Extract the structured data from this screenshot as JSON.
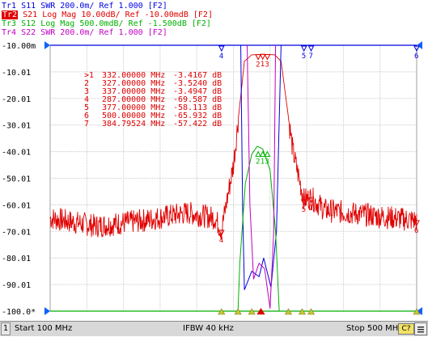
{
  "traces": [
    {
      "id": "Tr1",
      "param": "S11",
      "format": "SWR",
      "scale": "200.0m/",
      "ref": "Ref 1.000",
      "channel": "[F2]",
      "color": "#0000e0",
      "active": false
    },
    {
      "id": "Tr2",
      "param": "S21",
      "format": "Log Mag",
      "scale": "10.00dB/",
      "ref": "Ref -10.00mdB",
      "channel": "[F2]",
      "color": "#e00000",
      "active": true
    },
    {
      "id": "Tr3",
      "param": "S12",
      "format": "Log Mag",
      "scale": "500.0mdB/",
      "ref": "Ref -1.500dB",
      "channel": "[F2]",
      "color": "#00b000",
      "active": false
    },
    {
      "id": "Tr4",
      "param": "S22",
      "format": "SWR",
      "scale": "200.0m/",
      "ref": "Ref 1.000",
      "channel": "[F2]",
      "color": "#c000c0",
      "active": false
    }
  ],
  "y_axis_labels": [
    "-10.00m",
    "-10.01",
    "-20.01",
    "-30.01",
    "-40.01",
    "-50.01",
    "-60.01",
    "-70.01",
    "-80.01",
    "-90.01",
    "-100.0*"
  ],
  "markers": [
    {
      "index": 1,
      "label": ">1",
      "freq": "332.00000 MHz",
      "value": "-3.4167 dB",
      "freq_mhz": 332.0,
      "db": -3.4167
    },
    {
      "index": 2,
      "label": "2",
      "freq": "327.00000 MHz",
      "value": "-3.5240 dB",
      "freq_mhz": 327.0,
      "db": -3.524
    },
    {
      "index": 3,
      "label": "3",
      "freq": "337.00000 MHz",
      "value": "-3.4947 dB",
      "freq_mhz": 337.0,
      "db": -3.4947
    },
    {
      "index": 4,
      "label": "4",
      "freq": "287.00000 MHz",
      "value": "-69.587 dB",
      "freq_mhz": 287.0,
      "db": -69.587
    },
    {
      "index": 5,
      "label": "5",
      "freq": "377.00000 MHz",
      "value": "-58.113 dB",
      "freq_mhz": 377.0,
      "db": -58.113
    },
    {
      "index": 6,
      "label": "6",
      "freq": "500.00000 MHz",
      "value": "-65.932 dB",
      "freq_mhz": 500.0,
      "db": -65.932
    },
    {
      "index": 7,
      "label": "7",
      "freq": "384.79524 MHz",
      "value": "-57.422 dB",
      "freq_mhz": 384.79524,
      "db": -57.422
    }
  ],
  "status": {
    "channel": "1",
    "start": "Start 100 MHz",
    "ifbw": "IFBW 40 kHz",
    "stop": "Stop 500 MHz",
    "cal": "C?"
  },
  "chart_data": {
    "type": "line",
    "x_range_mhz": [
      100,
      500
    ],
    "y_range_db": [
      -100,
      0
    ],
    "grid": true,
    "series": [
      {
        "name": "S21",
        "values_db": [
          [
            100,
            -65
          ],
          [
            150,
            -68
          ],
          [
            200,
            -66
          ],
          [
            250,
            -63
          ],
          [
            280,
            -65
          ],
          [
            287,
            -69.587
          ],
          [
            300,
            -45
          ],
          [
            312,
            -6
          ],
          [
            320,
            -3.6
          ],
          [
            327,
            -3.524
          ],
          [
            332,
            -3.4167
          ],
          [
            337,
            -3.4947
          ],
          [
            345,
            -3.6
          ],
          [
            352,
            -6
          ],
          [
            365,
            -40
          ],
          [
            377,
            -58.113
          ],
          [
            384.79524,
            -57.422
          ],
          [
            400,
            -62
          ],
          [
            450,
            -64
          ],
          [
            500,
            -65.932
          ]
        ]
      }
    ]
  }
}
